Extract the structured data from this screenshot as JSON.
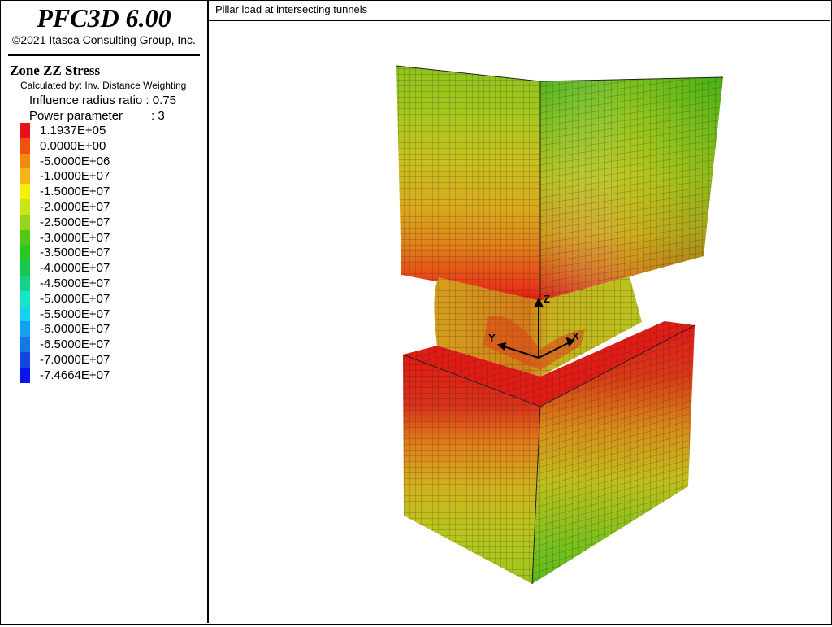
{
  "app": {
    "name": "PFC3D 6.00",
    "copyright": "©2021 Itasca Consulting Group, Inc."
  },
  "legend": {
    "title": "Zone ZZ Stress",
    "calculated_by": "Calculated by: Inv. Distance Weighting",
    "influence_label": "Influence radius ratio : 0.75",
    "power_label": "Power parameter",
    "power_value": ": 3",
    "entries": [
      {
        "label": "1.1937E+05",
        "color": "#e8101a"
      },
      {
        "label": "0.0000E+00",
        "color": "#f05010"
      },
      {
        "label": "-5.0000E+06",
        "color": "#f08a10"
      },
      {
        "label": "-1.0000E+07",
        "color": "#f5b41a"
      },
      {
        "label": "-1.5000E+07",
        "color": "#f5f00a"
      },
      {
        "label": "-2.0000E+07",
        "color": "#c8e614"
      },
      {
        "label": "-2.5000E+07",
        "color": "#94d61e"
      },
      {
        "label": "-3.0000E+07",
        "color": "#50c814"
      },
      {
        "label": "-3.5000E+07",
        "color": "#28c81e"
      },
      {
        "label": "-4.0000E+07",
        "color": "#14c850"
      },
      {
        "label": "-4.5000E+07",
        "color": "#14d28c"
      },
      {
        "label": "-5.0000E+07",
        "color": "#14e6c8"
      },
      {
        "label": "-5.5000E+07",
        "color": "#14d2f0"
      },
      {
        "label": "-6.0000E+07",
        "color": "#14a0f0"
      },
      {
        "label": "-6.5000E+07",
        "color": "#1478e6"
      },
      {
        "label": "-7.0000E+07",
        "color": "#1446e6"
      },
      {
        "label": "-7.4664E+07",
        "color": "#0a14f0"
      }
    ]
  },
  "plot": {
    "title": "Pillar load at intersecting tunnels",
    "axes": {
      "x": "X",
      "y": "Y",
      "z": "Z"
    }
  }
}
